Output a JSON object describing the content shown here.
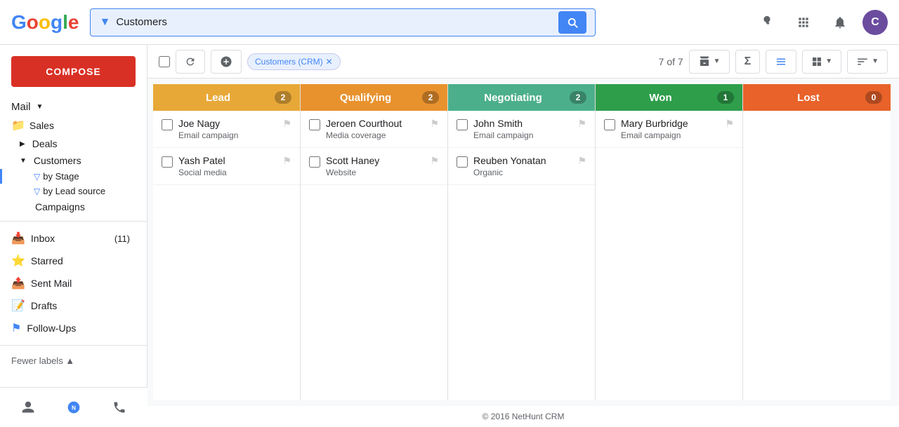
{
  "topbar": {
    "search_value": "Customers",
    "search_placeholder": "Search",
    "apps_icon": "⊞",
    "notif_icon": "🔔",
    "avatar_label": "C"
  },
  "sidebar": {
    "compose_label": "COMPOSE",
    "mail_label": "Mail",
    "nav_items": [
      {
        "id": "sales",
        "label": "Sales",
        "icon": "📁",
        "has_arrow": true
      },
      {
        "id": "deals",
        "label": "Deals",
        "icon": "",
        "has_arrow": true
      },
      {
        "id": "customers",
        "label": "Customers",
        "icon": "",
        "has_arrow": true
      },
      {
        "id": "by-stage",
        "label": "by Stage",
        "active": true
      },
      {
        "id": "by-lead-source",
        "label": "by Lead source"
      },
      {
        "id": "campaigns",
        "label": "Campaigns"
      }
    ],
    "mail_items": [
      {
        "id": "inbox",
        "label": "Inbox",
        "count": "(11)"
      },
      {
        "id": "starred",
        "label": "Starred"
      },
      {
        "id": "sent",
        "label": "Sent Mail"
      },
      {
        "id": "drafts",
        "label": "Drafts"
      },
      {
        "id": "followups",
        "label": "Follow-Ups",
        "flag": true
      }
    ],
    "fewer_labels": "Fewer labels ▲",
    "bottom_icons": [
      "👤",
      "📍",
      "📞"
    ]
  },
  "toolbar": {
    "checkbox_label": "",
    "refresh_label": "↻",
    "add_label": "⊕",
    "filter_tag": "Customers (CRM)",
    "count": "7 of 7",
    "archive_icon": "🗂",
    "sigma_icon": "Σ",
    "view_icon": "≡",
    "grid_icon": "⊞",
    "sort_icon": "⇅"
  },
  "kanban": {
    "columns": [
      {
        "id": "lead",
        "title": "Lead",
        "color_class": "col-lead",
        "badge": "2",
        "cards": [
          {
            "name": "Joe Nagy",
            "source": "Email campaign"
          },
          {
            "name": "Yash Patel",
            "source": "Social media"
          }
        ]
      },
      {
        "id": "qualifying",
        "title": "Qualifying",
        "color_class": "col-qualifying",
        "badge": "2",
        "cards": [
          {
            "name": "Jeroen Courthout",
            "source": "Media coverage"
          },
          {
            "name": "Scott Haney",
            "source": "Website"
          }
        ]
      },
      {
        "id": "negotiating",
        "title": "Negotiating",
        "color_class": "col-negotiating",
        "badge": "2",
        "cards": [
          {
            "name": "John Smith",
            "source": "Email campaign"
          },
          {
            "name": "Reuben Yonatan",
            "source": "Organic"
          }
        ]
      },
      {
        "id": "won",
        "title": "Won",
        "color_class": "col-won",
        "badge": "1",
        "cards": [
          {
            "name": "Mary Burbridge",
            "source": "Email campaign"
          }
        ]
      },
      {
        "id": "lost",
        "title": "Lost",
        "color_class": "col-lost",
        "badge": "0",
        "cards": []
      }
    ]
  },
  "footer": {
    "copyright": "© 2016 NetHunt CRM"
  }
}
